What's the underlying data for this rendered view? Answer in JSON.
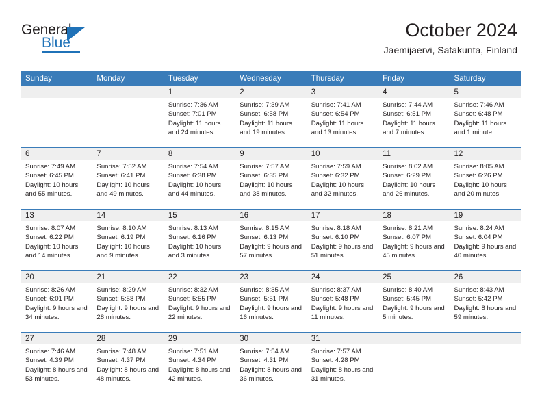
{
  "brand": {
    "name_top": "General",
    "name_bottom": "Blue",
    "triangle_color": "#1f72b8"
  },
  "header": {
    "title": "October 2024",
    "subtitle": "Jaemijaervi, Satakunta, Finland"
  },
  "theme": {
    "header_blue": "#3a7cb9",
    "day_band_gray": "#efefef",
    "text": "#231f20"
  },
  "labels": {
    "sunrise_prefix": "Sunrise:",
    "sunset_prefix": "Sunset:",
    "daylight_prefix": "Daylight:"
  },
  "weekdays": [
    "Sunday",
    "Monday",
    "Tuesday",
    "Wednesday",
    "Thursday",
    "Friday",
    "Saturday"
  ],
  "weeks": [
    [
      {
        "empty": true
      },
      {
        "empty": true
      },
      {
        "day": "1",
        "sunrise": "Sunrise: 7:36 AM",
        "sunset": "Sunset: 7:01 PM",
        "daylight": "Daylight: 11 hours and 24 minutes."
      },
      {
        "day": "2",
        "sunrise": "Sunrise: 7:39 AM",
        "sunset": "Sunset: 6:58 PM",
        "daylight": "Daylight: 11 hours and 19 minutes."
      },
      {
        "day": "3",
        "sunrise": "Sunrise: 7:41 AM",
        "sunset": "Sunset: 6:54 PM",
        "daylight": "Daylight: 11 hours and 13 minutes."
      },
      {
        "day": "4",
        "sunrise": "Sunrise: 7:44 AM",
        "sunset": "Sunset: 6:51 PM",
        "daylight": "Daylight: 11 hours and 7 minutes."
      },
      {
        "day": "5",
        "sunrise": "Sunrise: 7:46 AM",
        "sunset": "Sunset: 6:48 PM",
        "daylight": "Daylight: 11 hours and 1 minute."
      }
    ],
    [
      {
        "day": "6",
        "sunrise": "Sunrise: 7:49 AM",
        "sunset": "Sunset: 6:45 PM",
        "daylight": "Daylight: 10 hours and 55 minutes."
      },
      {
        "day": "7",
        "sunrise": "Sunrise: 7:52 AM",
        "sunset": "Sunset: 6:41 PM",
        "daylight": "Daylight: 10 hours and 49 minutes."
      },
      {
        "day": "8",
        "sunrise": "Sunrise: 7:54 AM",
        "sunset": "Sunset: 6:38 PM",
        "daylight": "Daylight: 10 hours and 44 minutes."
      },
      {
        "day": "9",
        "sunrise": "Sunrise: 7:57 AM",
        "sunset": "Sunset: 6:35 PM",
        "daylight": "Daylight: 10 hours and 38 minutes."
      },
      {
        "day": "10",
        "sunrise": "Sunrise: 7:59 AM",
        "sunset": "Sunset: 6:32 PM",
        "daylight": "Daylight: 10 hours and 32 minutes."
      },
      {
        "day": "11",
        "sunrise": "Sunrise: 8:02 AM",
        "sunset": "Sunset: 6:29 PM",
        "daylight": "Daylight: 10 hours and 26 minutes."
      },
      {
        "day": "12",
        "sunrise": "Sunrise: 8:05 AM",
        "sunset": "Sunset: 6:26 PM",
        "daylight": "Daylight: 10 hours and 20 minutes."
      }
    ],
    [
      {
        "day": "13",
        "sunrise": "Sunrise: 8:07 AM",
        "sunset": "Sunset: 6:22 PM",
        "daylight": "Daylight: 10 hours and 14 minutes."
      },
      {
        "day": "14",
        "sunrise": "Sunrise: 8:10 AM",
        "sunset": "Sunset: 6:19 PM",
        "daylight": "Daylight: 10 hours and 9 minutes."
      },
      {
        "day": "15",
        "sunrise": "Sunrise: 8:13 AM",
        "sunset": "Sunset: 6:16 PM",
        "daylight": "Daylight: 10 hours and 3 minutes."
      },
      {
        "day": "16",
        "sunrise": "Sunrise: 8:15 AM",
        "sunset": "Sunset: 6:13 PM",
        "daylight": "Daylight: 9 hours and 57 minutes."
      },
      {
        "day": "17",
        "sunrise": "Sunrise: 8:18 AM",
        "sunset": "Sunset: 6:10 PM",
        "daylight": "Daylight: 9 hours and 51 minutes."
      },
      {
        "day": "18",
        "sunrise": "Sunrise: 8:21 AM",
        "sunset": "Sunset: 6:07 PM",
        "daylight": "Daylight: 9 hours and 45 minutes."
      },
      {
        "day": "19",
        "sunrise": "Sunrise: 8:24 AM",
        "sunset": "Sunset: 6:04 PM",
        "daylight": "Daylight: 9 hours and 40 minutes."
      }
    ],
    [
      {
        "day": "20",
        "sunrise": "Sunrise: 8:26 AM",
        "sunset": "Sunset: 6:01 PM",
        "daylight": "Daylight: 9 hours and 34 minutes."
      },
      {
        "day": "21",
        "sunrise": "Sunrise: 8:29 AM",
        "sunset": "Sunset: 5:58 PM",
        "daylight": "Daylight: 9 hours and 28 minutes."
      },
      {
        "day": "22",
        "sunrise": "Sunrise: 8:32 AM",
        "sunset": "Sunset: 5:55 PM",
        "daylight": "Daylight: 9 hours and 22 minutes."
      },
      {
        "day": "23",
        "sunrise": "Sunrise: 8:35 AM",
        "sunset": "Sunset: 5:51 PM",
        "daylight": "Daylight: 9 hours and 16 minutes."
      },
      {
        "day": "24",
        "sunrise": "Sunrise: 8:37 AM",
        "sunset": "Sunset: 5:48 PM",
        "daylight": "Daylight: 9 hours and 11 minutes."
      },
      {
        "day": "25",
        "sunrise": "Sunrise: 8:40 AM",
        "sunset": "Sunset: 5:45 PM",
        "daylight": "Daylight: 9 hours and 5 minutes."
      },
      {
        "day": "26",
        "sunrise": "Sunrise: 8:43 AM",
        "sunset": "Sunset: 5:42 PM",
        "daylight": "Daylight: 8 hours and 59 minutes."
      }
    ],
    [
      {
        "day": "27",
        "sunrise": "Sunrise: 7:46 AM",
        "sunset": "Sunset: 4:39 PM",
        "daylight": "Daylight: 8 hours and 53 minutes."
      },
      {
        "day": "28",
        "sunrise": "Sunrise: 7:48 AM",
        "sunset": "Sunset: 4:37 PM",
        "daylight": "Daylight: 8 hours and 48 minutes."
      },
      {
        "day": "29",
        "sunrise": "Sunrise: 7:51 AM",
        "sunset": "Sunset: 4:34 PM",
        "daylight": "Daylight: 8 hours and 42 minutes."
      },
      {
        "day": "30",
        "sunrise": "Sunrise: 7:54 AM",
        "sunset": "Sunset: 4:31 PM",
        "daylight": "Daylight: 8 hours and 36 minutes."
      },
      {
        "day": "31",
        "sunrise": "Sunrise: 7:57 AM",
        "sunset": "Sunset: 4:28 PM",
        "daylight": "Daylight: 8 hours and 31 minutes."
      },
      {
        "empty": true
      },
      {
        "empty": true
      }
    ]
  ]
}
